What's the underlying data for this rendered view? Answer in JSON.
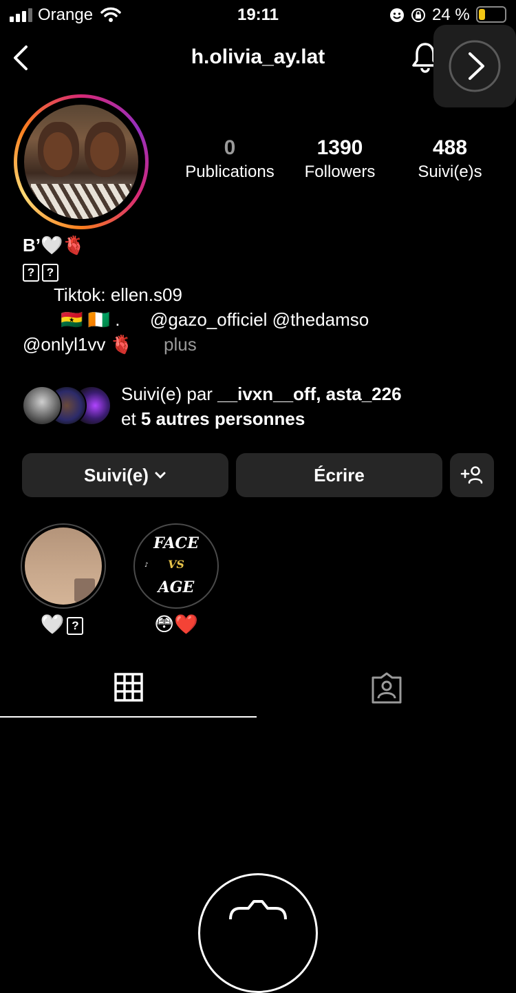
{
  "status_bar": {
    "carrier": "Orange",
    "time": "19:11",
    "battery_percent": "24 %"
  },
  "header": {
    "username": "h.olivia_ay.lat"
  },
  "profile": {
    "stats": [
      {
        "value": "0",
        "label": "Publications"
      },
      {
        "value": "1390",
        "label": "Followers"
      },
      {
        "value": "488",
        "label": "Suivi(e)s"
      }
    ],
    "bio": {
      "line1": "B’🤍🫀",
      "line3": "Tiktok: ellen.s09",
      "line4_flags": "🇬🇭 🇨🇮 .",
      "line4_mentions": "@gazo_officiel @thedamso",
      "line5_mention": "@onlyl1vv 🫀",
      "more": "plus"
    },
    "followed_by": {
      "prefix": "Suivi(e) par",
      "names": "__ivxn__off, asta_226",
      "and": "et",
      "others": "5 autres personnes"
    }
  },
  "actions": {
    "following_label": "Suivi(e)",
    "message_label": "Écrire"
  },
  "highlights": [
    {
      "label": "🤍"
    },
    {
      "label": "😳❤️",
      "cover_text_1": "FACE",
      "cover_text_2": "VS",
      "cover_text_3": "AGE"
    }
  ],
  "colors": {
    "background": "#000000",
    "button": "#262626",
    "muted_text": "#9a9a9a",
    "story_ring_start": "#feda75",
    "story_ring_mid": "#fa7e1e",
    "story_ring_end": "#d62976"
  }
}
